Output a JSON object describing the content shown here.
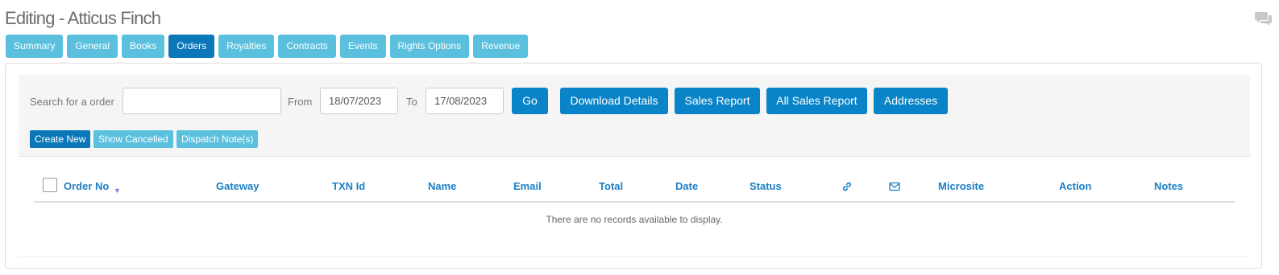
{
  "page": {
    "title": "Editing - Atticus Finch"
  },
  "tabs": [
    {
      "label": "Summary"
    },
    {
      "label": "General"
    },
    {
      "label": "Books"
    },
    {
      "label": "Orders",
      "active": true
    },
    {
      "label": "Royalties"
    },
    {
      "label": "Contracts"
    },
    {
      "label": "Events"
    },
    {
      "label": "Rights Options"
    },
    {
      "label": "Revenue"
    }
  ],
  "search": {
    "label": "Search for a order",
    "value": "",
    "from_label": "From",
    "from_value": "18/07/2023",
    "to_label": "To",
    "to_value": "17/08/2023",
    "go_label": "Go"
  },
  "actions": {
    "download_details": "Download Details",
    "sales_report": "Sales Report",
    "all_sales_report": "All Sales Report",
    "addresses": "Addresses",
    "create_new": "Create New",
    "show_cancelled": "Show Cancelled",
    "dispatch_notes": "Dispatch Note(s)"
  },
  "grid": {
    "columns": {
      "order_no": "Order No",
      "gateway": "Gateway",
      "txn_id": "TXN Id",
      "name": "Name",
      "email": "Email",
      "total": "Total",
      "date": "Date",
      "status": "Status",
      "link_icon": "link-icon",
      "mail_icon": "envelope-icon",
      "microsite": "Microsite",
      "action": "Action",
      "notes": "Notes"
    },
    "sort_indicator": "▼",
    "empty_message": "There are no records available to display."
  },
  "colors": {
    "tab": "#5bc0de",
    "tab_active": "#0a77b8",
    "button": "#0a84c8",
    "header_text": "#1b7fc4"
  }
}
